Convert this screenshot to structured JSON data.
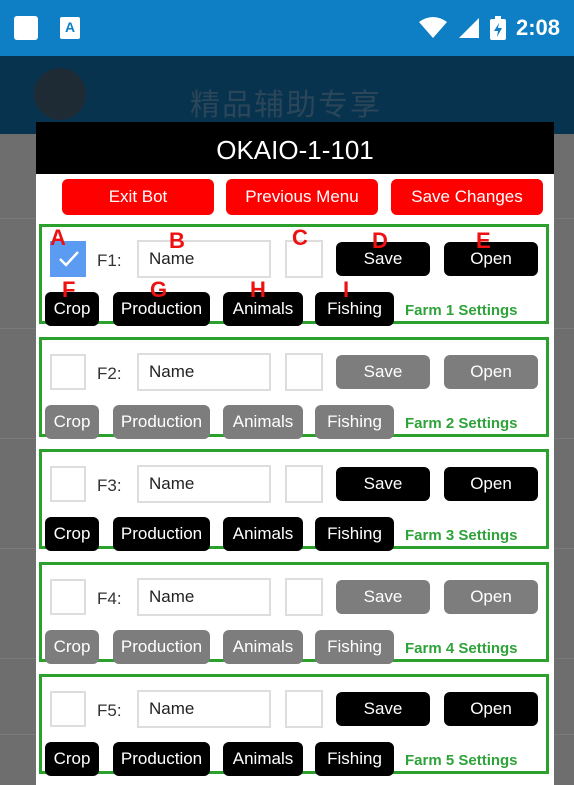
{
  "status_bar": {
    "a_badge": "A",
    "time": "2:08",
    "icons": [
      "notification-square-icon",
      "a-notification-icon",
      "wifi-icon",
      "signal-icon",
      "battery-charging-icon"
    ]
  },
  "app_bar": {
    "title": "精品辅助专享"
  },
  "dialog": {
    "title": "OKAIO-1-101",
    "buttons": {
      "exit_bot": "Exit Bot",
      "previous_menu": "Previous Menu",
      "save_changes": "Save Changes"
    }
  },
  "markers": [
    "A",
    "B",
    "C",
    "D",
    "E",
    "F",
    "G",
    "H",
    "I"
  ],
  "farms": [
    {
      "label": "F1:",
      "name": "Name",
      "checked": true,
      "enabled": true,
      "save": "Save",
      "open": "Open",
      "crop": "Crop",
      "production": "Production",
      "animals": "Animals",
      "fishing": "Fishing",
      "settings": "Farm 1 Settings"
    },
    {
      "label": "F2:",
      "name": "Name",
      "checked": false,
      "enabled": false,
      "save": "Save",
      "open": "Open",
      "crop": "Crop",
      "production": "Production",
      "animals": "Animals",
      "fishing": "Fishing",
      "settings": "Farm 2 Settings"
    },
    {
      "label": "F3:",
      "name": "Name",
      "checked": false,
      "enabled": true,
      "save": "Save",
      "open": "Open",
      "crop": "Crop",
      "production": "Production",
      "animals": "Animals",
      "fishing": "Fishing",
      "settings": "Farm 3 Settings"
    },
    {
      "label": "F4:",
      "name": "Name",
      "checked": false,
      "enabled": false,
      "save": "Save",
      "open": "Open",
      "crop": "Crop",
      "production": "Production",
      "animals": "Animals",
      "fishing": "Fishing",
      "settings": "Farm 4 Settings"
    },
    {
      "label": "F5:",
      "name": "Name",
      "checked": false,
      "enabled": true,
      "save": "Save",
      "open": "Open",
      "crop": "Crop",
      "production": "Production",
      "animals": "Animals",
      "fishing": "Fishing",
      "settings": "Farm 5 Settings"
    }
  ],
  "colors": {
    "status_bar": "#0e7fc4",
    "exit_buttons": "#ff0000",
    "farm_border": "#2ca02c",
    "settings_text": "#2fa23a",
    "checkbox_checked": "#5b9cf2",
    "active_button": "#000000",
    "disabled_button": "#7d7d7d",
    "marker_text": "#ee1111"
  }
}
